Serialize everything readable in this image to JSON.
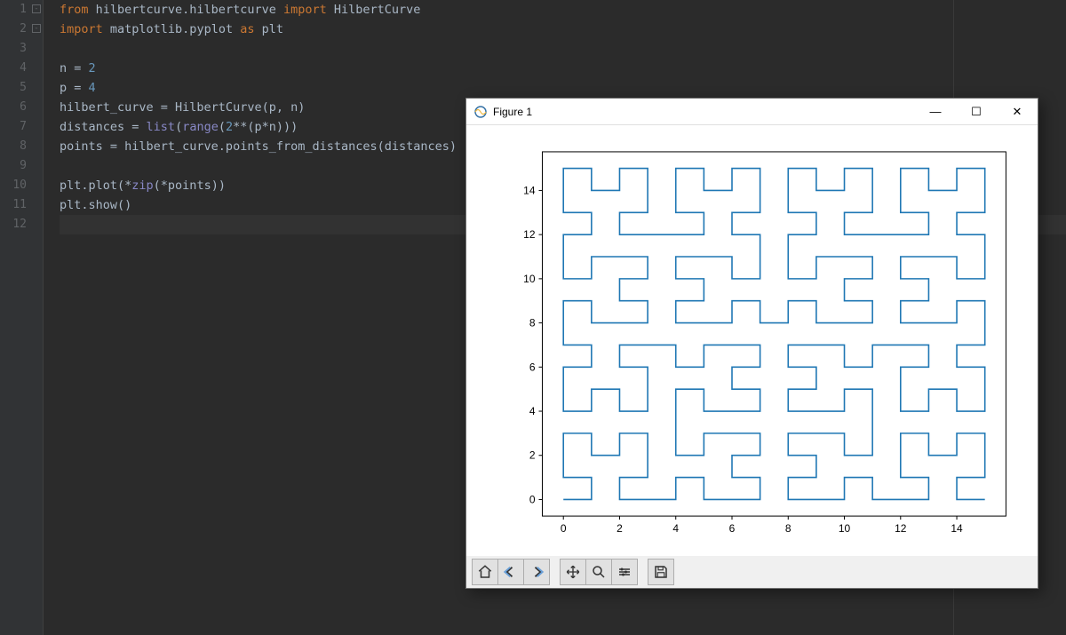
{
  "editor": {
    "lines": [
      {
        "n": 1,
        "fold": true,
        "tokens": [
          {
            "t": "from ",
            "c": "kw"
          },
          {
            "t": "hilbertcurve.hilbertcurve ",
            "c": "id"
          },
          {
            "t": "import ",
            "c": "kw"
          },
          {
            "t": "HilbertCurve",
            "c": "id"
          }
        ]
      },
      {
        "n": 2,
        "fold": true,
        "tokens": [
          {
            "t": "import ",
            "c": "kw"
          },
          {
            "t": "matplotlib.pyplot ",
            "c": "id"
          },
          {
            "t": "as ",
            "c": "kw"
          },
          {
            "t": "plt",
            "c": "id"
          }
        ]
      },
      {
        "n": 3,
        "tokens": []
      },
      {
        "n": 4,
        "tokens": [
          {
            "t": "n = ",
            "c": "id"
          },
          {
            "t": "2",
            "c": "num"
          }
        ]
      },
      {
        "n": 5,
        "tokens": [
          {
            "t": "p = ",
            "c": "id"
          },
          {
            "t": "4",
            "c": "num"
          }
        ]
      },
      {
        "n": 6,
        "tokens": [
          {
            "t": "hilbert_curve = HilbertCurve(p",
            "c": "id"
          },
          {
            "t": ", ",
            "c": "op"
          },
          {
            "t": "n)",
            "c": "id"
          }
        ]
      },
      {
        "n": 7,
        "tokens": [
          {
            "t": "distances = ",
            "c": "id"
          },
          {
            "t": "list",
            "c": "builtin"
          },
          {
            "t": "(",
            "c": "id"
          },
          {
            "t": "range",
            "c": "builtin"
          },
          {
            "t": "(",
            "c": "id"
          },
          {
            "t": "2",
            "c": "num"
          },
          {
            "t": "**(p*n)))",
            "c": "id"
          }
        ]
      },
      {
        "n": 8,
        "tokens": [
          {
            "t": "points = hilbert_curve.points_from_distances(distances)",
            "c": "id"
          }
        ]
      },
      {
        "n": 9,
        "tokens": []
      },
      {
        "n": 10,
        "tokens": [
          {
            "t": "plt.plot(*",
            "c": "id"
          },
          {
            "t": "zip",
            "c": "builtin"
          },
          {
            "t": "(*points))",
            "c": "id"
          }
        ]
      },
      {
        "n": 11,
        "tokens": [
          {
            "t": "plt.show()",
            "c": "id"
          }
        ]
      },
      {
        "n": 12,
        "active": true,
        "tokens": []
      }
    ]
  },
  "window": {
    "title": "Figure 1",
    "controls": {
      "min": "—",
      "max": "☐",
      "close": "✕"
    }
  },
  "toolbar": {
    "home": "home-icon",
    "back": "back-icon",
    "forward": "forward-icon",
    "pan": "pan-icon",
    "zoom": "zoom-icon",
    "subplots": "subplots-icon",
    "save": "save-icon"
  },
  "chart_data": {
    "type": "line",
    "title": "",
    "xlabel": "",
    "ylabel": "",
    "xlim": [
      0,
      15
    ],
    "ylim": [
      0,
      15
    ],
    "xticks": [
      0,
      2,
      4,
      6,
      8,
      10,
      12,
      14
    ],
    "yticks": [
      0,
      2,
      4,
      6,
      8,
      10,
      12,
      14
    ],
    "hilbert": {
      "p": 4,
      "n": 2
    },
    "line_color": "#1f77b4"
  }
}
